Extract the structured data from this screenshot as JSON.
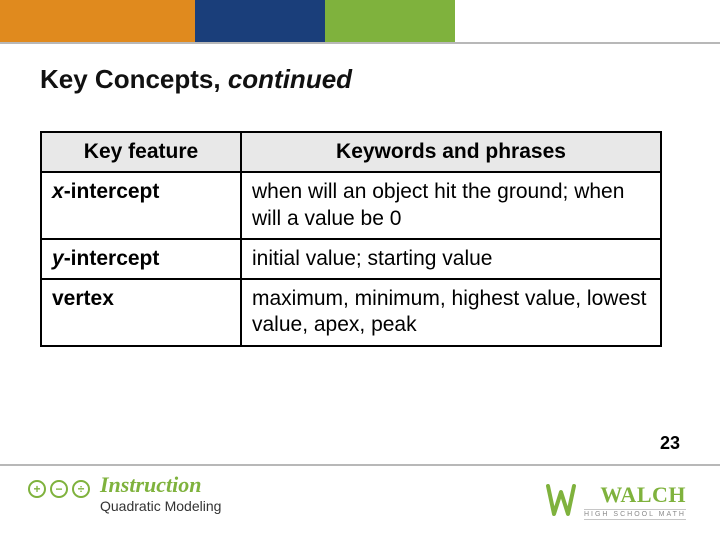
{
  "title": {
    "main": "Key Concepts, ",
    "continued": "continued"
  },
  "table": {
    "headers": [
      "Key feature",
      "Keywords and phrases"
    ],
    "rows": [
      {
        "feature_var": "x",
        "feature_rest": "-intercept",
        "phrases": "when will an object hit the ground; when will a value be 0"
      },
      {
        "feature_var": "y",
        "feature_rest": "-intercept",
        "phrases": "initial value; starting value"
      },
      {
        "feature_var": "",
        "feature_rest": "vertex",
        "phrases": "maximum, minimum, highest value, lowest value, apex, peak"
      }
    ]
  },
  "page_number": "23",
  "footer": {
    "badge_icons": [
      "+",
      "−",
      "÷"
    ],
    "instruction_label": "Instruction",
    "subtitle": "Quadratic Modeling",
    "brand": "WALCH",
    "tagline": "HIGH SCHOOL MATH"
  }
}
